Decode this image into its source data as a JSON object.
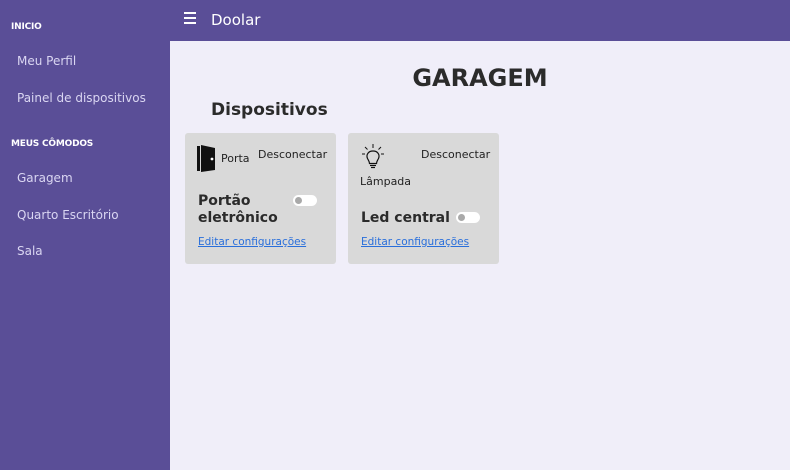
{
  "sidebar": {
    "section_inicio": "INICIO",
    "items_inicio": [
      "Meu Perfil",
      "Painel de dispositivos"
    ],
    "section_comodos": "MEUS CÔMODOS",
    "items_comodos": [
      "Garagem",
      "Quarto Escritório",
      "Sala"
    ]
  },
  "topbar": {
    "title": "Doolar",
    "menu_icon": "hamburger-icon"
  },
  "main": {
    "page_title": "GARAGEM",
    "section_title": "Dispositivos",
    "devices": [
      {
        "icon": "door-icon",
        "type": "Porta",
        "disconnect_label": "Desconectar",
        "name": "Portão eletrônico",
        "toggle_on": false,
        "edit_label": "Editar configurações"
      },
      {
        "icon": "lightbulb-icon",
        "type": "Lâmpada",
        "disconnect_label": "Desconectar",
        "name": "Led central",
        "toggle_on": false,
        "edit_label": "Editar configurações"
      }
    ]
  },
  "colors": {
    "accent": "#5a4e97",
    "background": "#f0eef9",
    "card": "#d9d9d9",
    "link": "#2a6fdb"
  }
}
